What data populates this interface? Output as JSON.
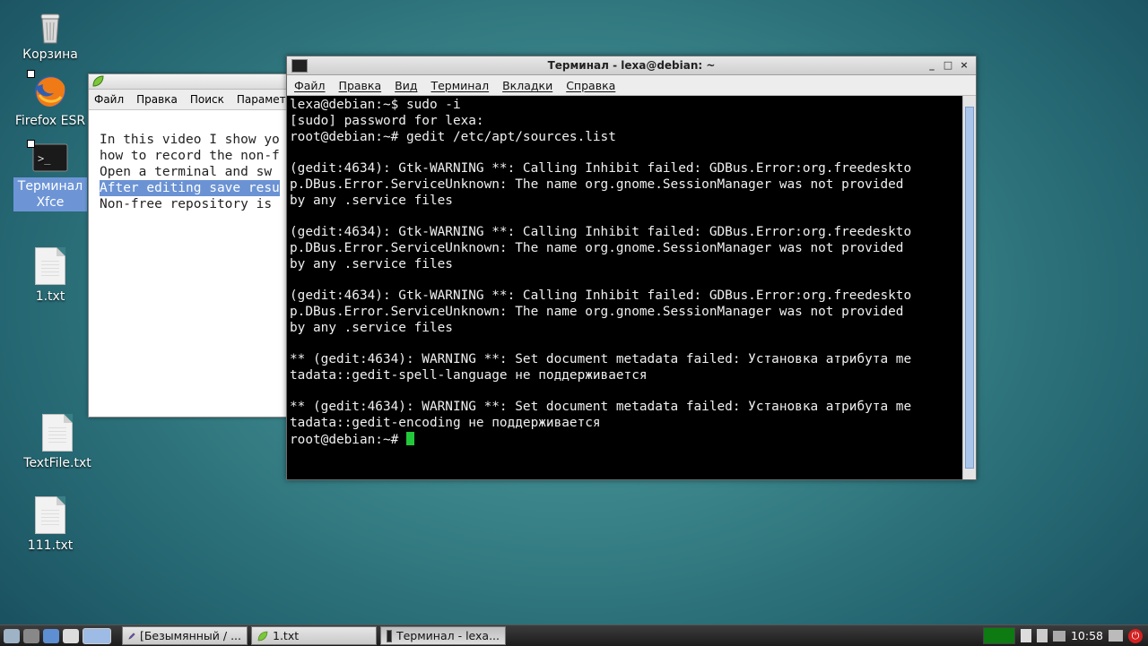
{
  "desktop": {
    "icons": [
      {
        "label": "Корзина",
        "kind": "trash-icon"
      },
      {
        "label": "Firefox ESR",
        "kind": "firefox-icon"
      },
      {
        "label": "Терминал Xfce",
        "kind": "terminal-icon"
      },
      {
        "label": "1.txt",
        "kind": "text-file-icon"
      },
      {
        "label": "TextFile.txt",
        "kind": "text-file-icon"
      },
      {
        "label": "111.txt",
        "kind": "text-file-icon"
      }
    ]
  },
  "editor": {
    "menu": [
      "Файл",
      "Правка",
      "Поиск",
      "Парамет"
    ],
    "lines": [
      "In this video I show yo",
      "how to record the non-f",
      "Open a terminal and sw",
      "After editing save resu",
      "Non-free repository is"
    ],
    "selected_line": 3
  },
  "terminal": {
    "title": "Терминал - lexa@debian: ~",
    "window_controls": [
      "_",
      "□",
      "×"
    ],
    "menu": [
      "Файл",
      "Правка",
      "Вид",
      "Терминал",
      "Вкладки",
      "Справка"
    ],
    "lines": [
      "lexa@debian:~$ sudo -i",
      "[sudo] password for lexa:",
      "root@debian:~# gedit /etc/apt/sources.list",
      "",
      "(gedit:4634): Gtk-WARNING **: Calling Inhibit failed: GDBus.Error:org.freedeskto",
      "p.DBus.Error.ServiceUnknown: The name org.gnome.SessionManager was not provided",
      "by any .service files",
      "",
      "(gedit:4634): Gtk-WARNING **: Calling Inhibit failed: GDBus.Error:org.freedeskto",
      "p.DBus.Error.ServiceUnknown: The name org.gnome.SessionManager was not provided",
      "by any .service files",
      "",
      "(gedit:4634): Gtk-WARNING **: Calling Inhibit failed: GDBus.Error:org.freedeskto",
      "p.DBus.Error.ServiceUnknown: The name org.gnome.SessionManager was not provided",
      "by any .service files",
      "",
      "** (gedit:4634): WARNING **: Set document metadata failed: Установка атрибута me",
      "tadata::gedit-spell-language не поддерживается",
      "",
      "** (gedit:4634): WARNING **: Set document metadata failed: Установка атрибута me",
      "tadata::gedit-encoding не поддерживается"
    ],
    "prompt": "root@debian:~# ",
    "cursor_color": "#22c83a"
  },
  "taskbar": {
    "tasks": [
      {
        "label": "[Безымянный / ...",
        "icon": "pen-icon"
      },
      {
        "label": "1.txt",
        "icon": "leaf-icon"
      },
      {
        "label": "Терминал - lexa...",
        "icon": "terminal-icon",
        "active": true
      }
    ],
    "clock": "10:58"
  }
}
